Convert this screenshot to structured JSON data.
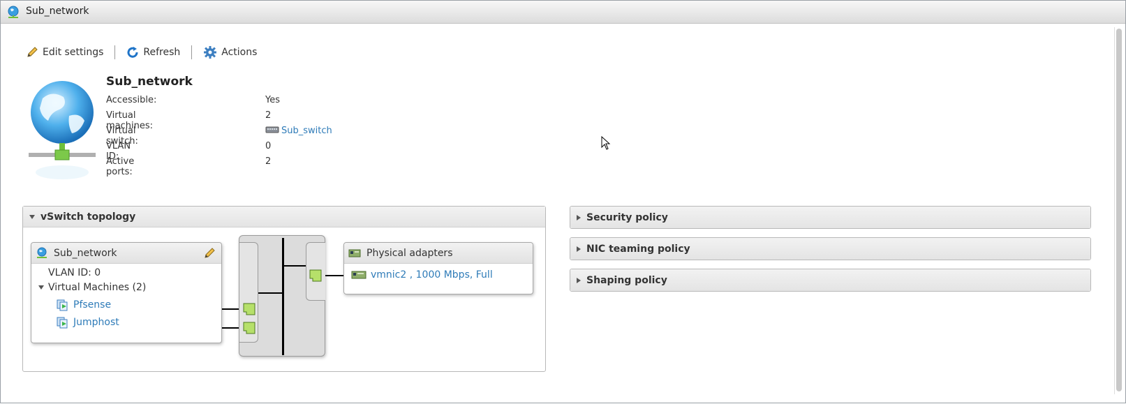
{
  "window": {
    "title": "Sub_network"
  },
  "toolbar": {
    "edit_label": "Edit settings",
    "refresh_label": "Refresh",
    "actions_label": "Actions"
  },
  "summary": {
    "name": "Sub_network",
    "properties": [
      {
        "label": "Accessible:",
        "value": "Yes"
      },
      {
        "label": "Virtual machines:",
        "value": "2"
      },
      {
        "label": "Virtual switch:",
        "value": "Sub_switch"
      },
      {
        "label": "VLAN ID:",
        "value": "0"
      },
      {
        "label": "Active ports:",
        "value": "2"
      }
    ]
  },
  "topology": {
    "title": "vSwitch topology",
    "portgroup": {
      "name": "Sub_network",
      "vlan": "VLAN ID: 0",
      "vms_label": "Virtual Machines (2)",
      "vms": [
        "Pfsense",
        "Jumphost"
      ]
    },
    "physical": {
      "title": "Physical adapters",
      "nics": [
        "vmnic2 , 1000 Mbps, Full"
      ]
    }
  },
  "policies": [
    {
      "label": "Security policy"
    },
    {
      "label": "NIC teaming policy"
    },
    {
      "label": "Shaping policy"
    }
  ],
  "colors": {
    "link": "#2e7bb8",
    "port_green": "#b6e06a",
    "globe_blue": "#3a9ee0"
  }
}
